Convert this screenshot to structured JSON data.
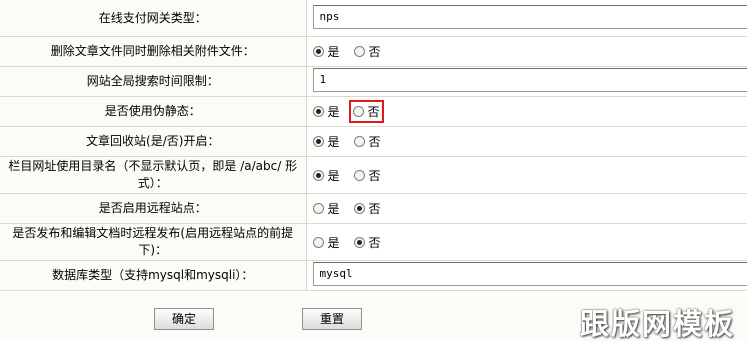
{
  "settings": {
    "rows": [
      {
        "label": "在线支付网关类型：",
        "value": "nps"
      },
      {
        "label": "删除文章文件同时删除相关附件文件：",
        "yes": "是",
        "no": "否"
      },
      {
        "label": "网站全局搜索时间限制：",
        "value": "1"
      },
      {
        "label": "是否使用伪静态：",
        "yes": "是",
        "no": "否"
      },
      {
        "label": "文章回收站(是/否)开启：",
        "yes": "是",
        "no": "否"
      },
      {
        "label": "栏目网址使用目录名（不显示默认页，即是 /a/abc/ 形式）：",
        "yes": "是",
        "no": "否"
      },
      {
        "label": "是否启用远程站点：",
        "yes": "是",
        "no": "否"
      },
      {
        "label": "是否发布和编辑文档时远程发布(启用远程站点的前提下)：",
        "yes": "是",
        "no": "否"
      },
      {
        "label": "数据库类型（支持mysql和mysqli）：",
        "value": "mysql"
      }
    ]
  },
  "buttons": {
    "confirm": "确定",
    "reset": "重置"
  },
  "watermark": "跟版网模板",
  "colors": {
    "highlight_border": "#e0191d",
    "label_bg": "#fbfcf6",
    "border": "#d9dcc9"
  }
}
